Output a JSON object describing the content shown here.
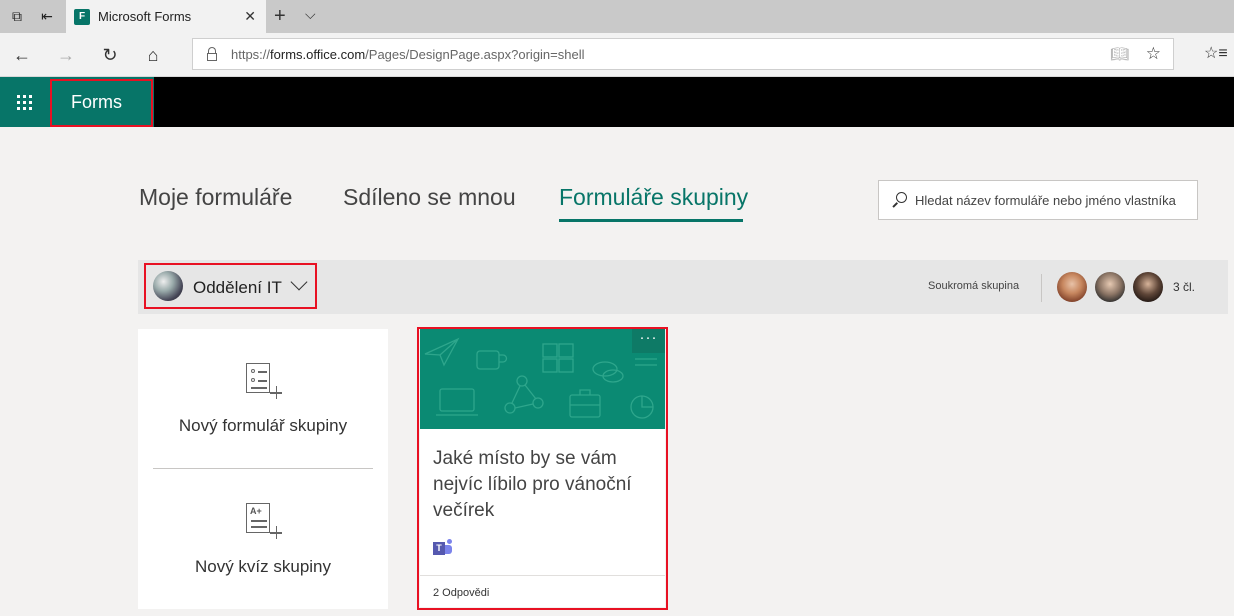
{
  "browser": {
    "tab_title": "Microsoft Forms",
    "favicon_text": "F",
    "url_prefix": "https://",
    "url_domain": "forms.office.com",
    "url_path": "/Pages/DesignPage.aspx?origin=shell"
  },
  "app": {
    "name": "Forms",
    "accent": "#077568",
    "highlight_color": "#e81123"
  },
  "tabs": [
    {
      "label": "Moje formuláře",
      "active": false
    },
    {
      "label": "Sdíleno se mnou",
      "active": false
    },
    {
      "label": "Formuláře skupiny",
      "active": true
    }
  ],
  "search": {
    "placeholder": "Hledat název formuláře nebo jméno vlastníka"
  },
  "group": {
    "name": "Oddělení IT",
    "privacy": "Soukromá skupina",
    "member_count": "3 čl."
  },
  "create": {
    "new_form": "Nový formulář skupiny",
    "new_quiz": "Nový kvíz skupiny",
    "quiz_icon_text": "A+"
  },
  "form_card": {
    "title": "Jaké místo by se vám nejvíc líbilo pro vánoční večírek",
    "responses": "2 Odpovědi",
    "menu": "···",
    "teams_letter": "T"
  }
}
